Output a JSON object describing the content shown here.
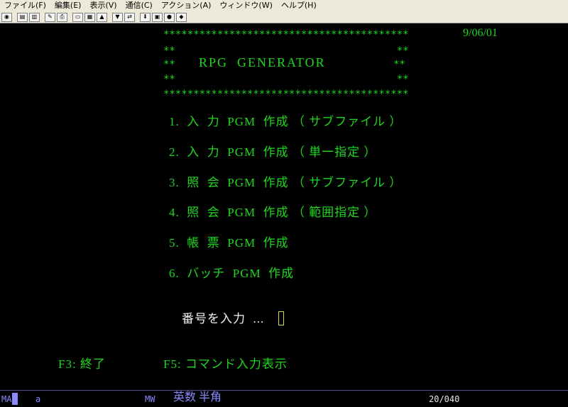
{
  "menu": {
    "file": "ファイル(F)",
    "edit": "編集(E)",
    "view": "表示(V)",
    "comm": "通信(C)",
    "action": "アクション(A)",
    "window": "ウィンドウ(W)",
    "help": "ヘルプ(H)"
  },
  "toolbar": {
    "icons": [
      "connect-icon",
      "copy-icon",
      "paste-icon",
      "edit-icon",
      "print-icon",
      "screen-icon",
      "macro-icon",
      "send-icon",
      "receive-icon",
      "transfer-icon",
      "download-icon",
      "clipboard-icon",
      "globe-icon",
      "settings-icon"
    ]
  },
  "screen": {
    "border_line": "*****************************************",
    "border_side": "**                                     **",
    "title": "RPG  GENERATOR",
    "date": "9/06/01",
    "options": [
      "1.  入  力  PGM  作成 （ サブファイル ）",
      "2.  入  力  PGM  作成 （ 単一指定 ）",
      "3.  照  会  PGM  作成 （ サブファイル ）",
      "4.  照  会  PGM  作成 （ 範囲指定 ）",
      "5.  帳  票  PGM  作成",
      "6.  バッチ  PGM  作成"
    ],
    "prompt_label": "番号を入力  ...",
    "f3_label": "F3: 終了",
    "f5_label": "F5: コマンド入力表示"
  },
  "status": {
    "mode": "MA",
    "char": "a",
    "mw": "MW",
    "ime": "英数 半角",
    "position": "20/040"
  }
}
